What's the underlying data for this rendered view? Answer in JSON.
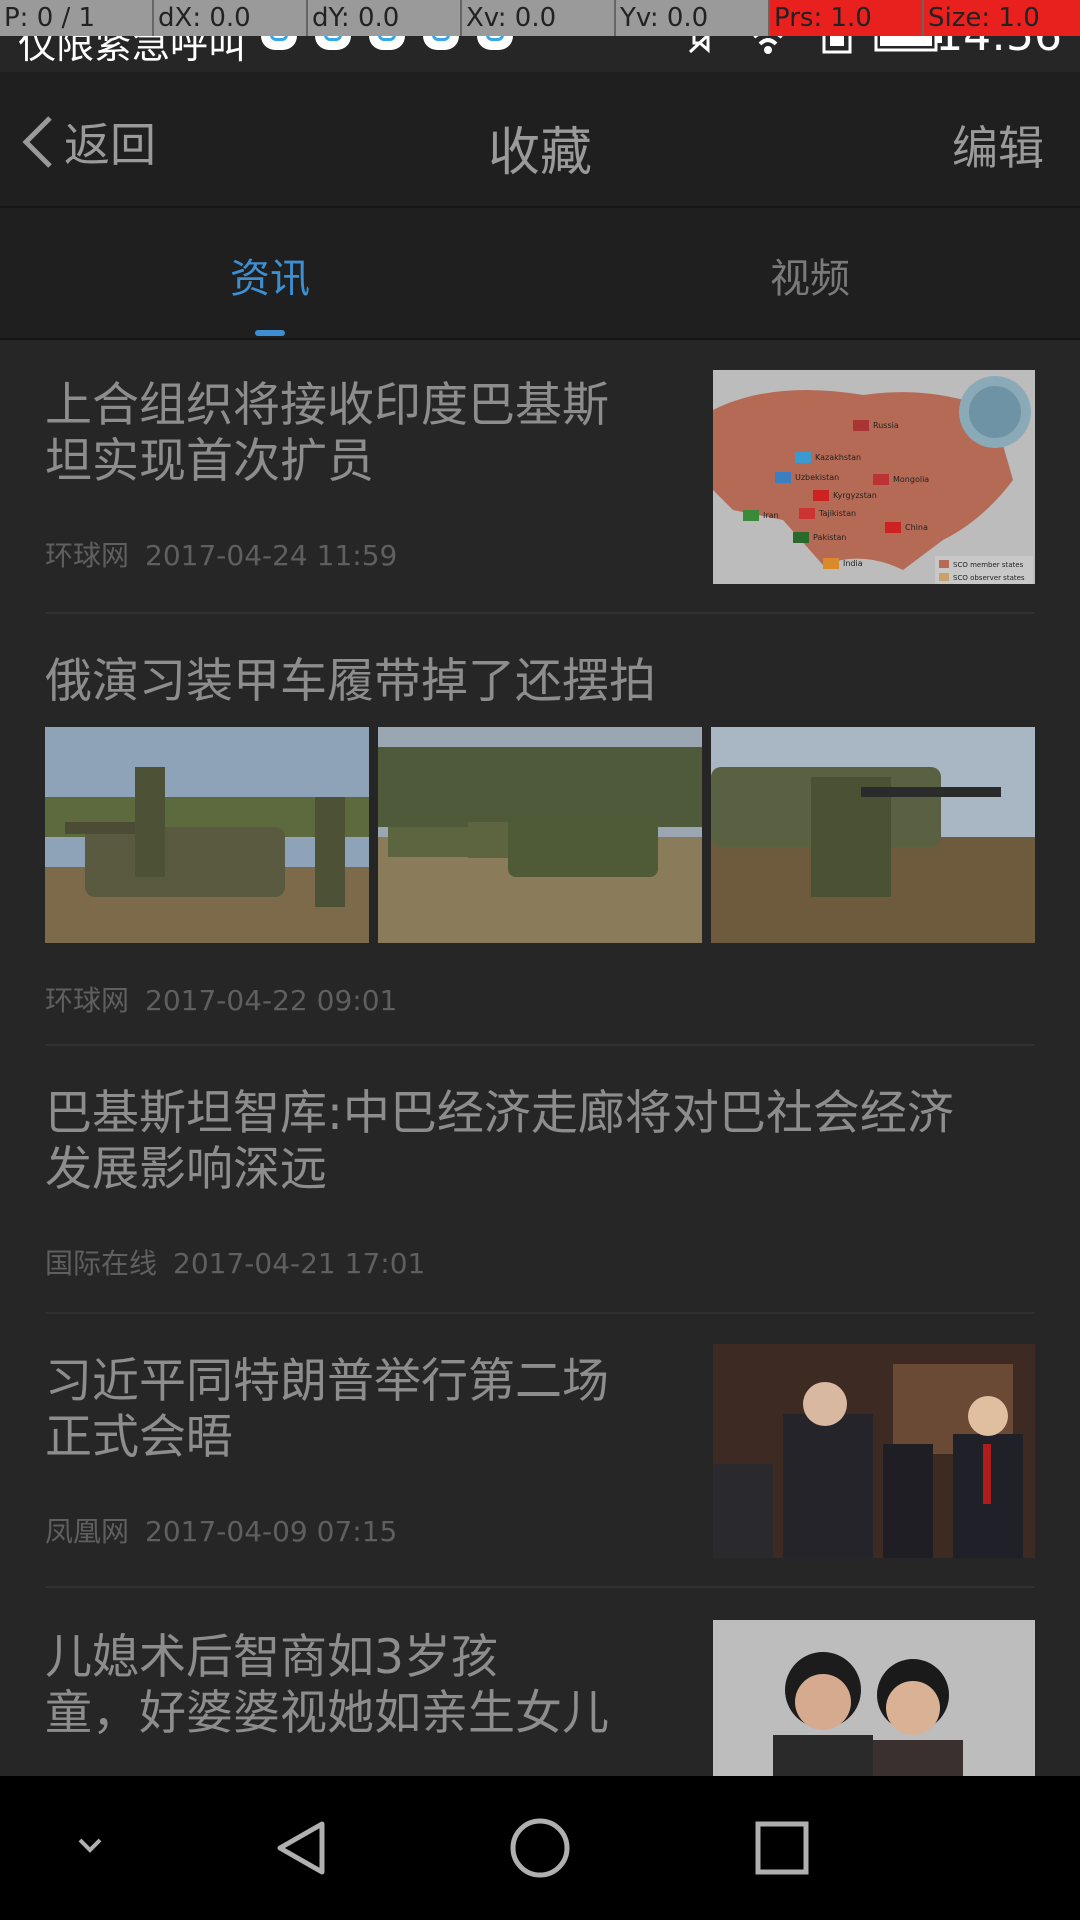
{
  "debug_bar": {
    "p": "P: 0 / 1",
    "dx": "dX: 0.0",
    "dy": "dY: 0.0",
    "xv": "Xv: 0.0",
    "yv": "Yv: 0.0",
    "prs": "Prs: 1.0",
    "size": "Size: 1.0"
  },
  "status_bar": {
    "carrier": "仅限紧急呼叫",
    "more": "···",
    "time": "14:56",
    "icons": [
      "cloud-notification-icon",
      "cloud-notification-icon",
      "cloud-notification-icon",
      "cloud-notification-icon",
      "cloud-notification-icon",
      "mute-icon",
      "wifi-icon",
      "sim-icon",
      "battery-icon"
    ]
  },
  "header": {
    "back_label": "返回",
    "title": "收藏",
    "edit_label": "编辑"
  },
  "tabs": [
    {
      "label": "资讯",
      "active": true
    },
    {
      "label": "视频",
      "active": false
    }
  ],
  "colors": {
    "accent": "#3d8fd1",
    "background": "#262626",
    "header": "#1f1f1f"
  },
  "articles": [
    {
      "title_line1": "上合组织将接收印度巴基斯",
      "title_line2": "坦实现首次扩员",
      "source": "环球网",
      "time": "2017-04-24 11:59",
      "image": "sco-map-thumbnail",
      "map_labels": [
        "Russia",
        "Kazakhstan",
        "Uzbekistan",
        "Mongolia",
        "Kyrgyzstan",
        "Tajikistan",
        "Iran",
        "China",
        "Pakistan",
        "India",
        "SCO member states",
        "SCO observer states"
      ]
    },
    {
      "title": "俄演习装甲车履带掉了还摆拍",
      "source": "环球网",
      "time": "2017-04-22 09:01",
      "images": [
        "soldiers-with-armored-vehicle",
        "armored-vehicle-column",
        "soldier-aiming-rifle"
      ]
    },
    {
      "title_line1": "巴基斯坦智库:中巴经济走廊将对巴社会经济",
      "title_line2": "发展影响深远",
      "source": "国际在线",
      "time": "2017-04-21 17:01"
    },
    {
      "title_line1": "习近平同特朗普举行第二场",
      "title_line2": "正式会晤",
      "source": "凤凰网",
      "time": "2017-04-09 07:15",
      "image": "leaders-meeting-photo"
    },
    {
      "title_line1": "儿媳术后智商如3岁孩",
      "title_line2": "童，好婆婆视她如亲生女儿",
      "image": "mother-son-photo"
    }
  ],
  "nav_bar": [
    "collapse-icon",
    "back-icon",
    "home-icon",
    "recents-icon"
  ]
}
